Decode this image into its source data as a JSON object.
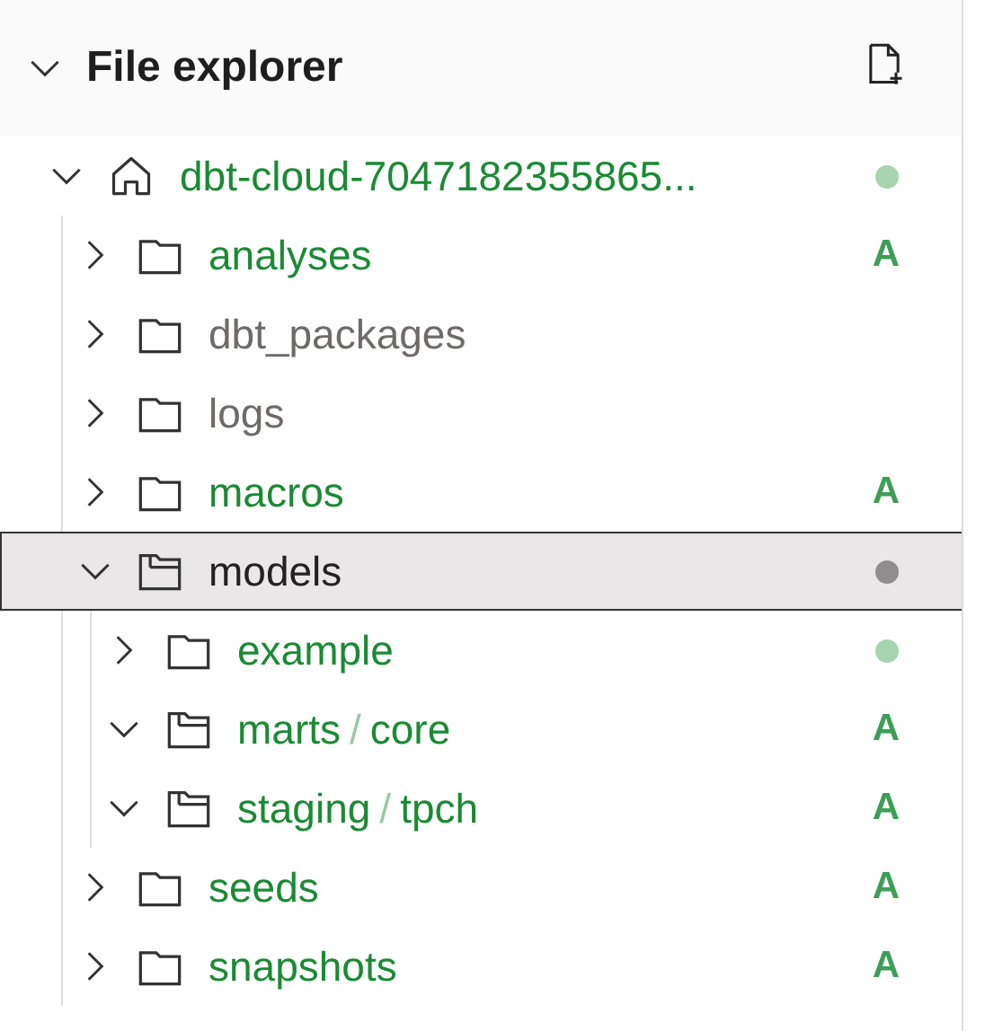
{
  "panel": {
    "title": "File explorer",
    "expanded": true
  },
  "tree": [
    {
      "kind": "root",
      "segments": [
        "dbt-cloud-7047182355865..."
      ],
      "color": "#1b8a34",
      "expanded": true,
      "selected": false,
      "badge": {
        "kind": "dot",
        "color": "#a6d5ad"
      },
      "children": [
        {
          "kind": "folder",
          "segments": [
            "analyses"
          ],
          "color": "#1b8a34",
          "expanded": false,
          "selected": false,
          "badge": {
            "kind": "letter",
            "text": "A"
          }
        },
        {
          "kind": "folder",
          "segments": [
            "dbt_packages"
          ],
          "color": "#6f6a6a",
          "expanded": false,
          "selected": false
        },
        {
          "kind": "folder",
          "segments": [
            "logs"
          ],
          "color": "#6f6a6a",
          "expanded": false,
          "selected": false
        },
        {
          "kind": "folder",
          "segments": [
            "macros"
          ],
          "color": "#1b8a34",
          "expanded": false,
          "selected": false,
          "badge": {
            "kind": "letter",
            "text": "A"
          }
        },
        {
          "kind": "folder",
          "segments": [
            "models"
          ],
          "color": "#222222",
          "expanded": true,
          "selected": true,
          "badge": {
            "kind": "dot",
            "color": "#8f8d8e"
          },
          "children": [
            {
              "kind": "folder",
              "segments": [
                "example"
              ],
              "color": "#1b8a34",
              "expanded": false,
              "selected": false,
              "badge": {
                "kind": "dot",
                "color": "#a6d5ad"
              }
            },
            {
              "kind": "folder",
              "segments": [
                "marts",
                "/",
                "core"
              ],
              "color": "#1b8a34",
              "expanded": true,
              "selected": false,
              "badge": {
                "kind": "letter",
                "text": "A"
              }
            },
            {
              "kind": "folder",
              "segments": [
                "staging",
                "/",
                "tpch"
              ],
              "color": "#1b8a34",
              "expanded": true,
              "selected": false,
              "badge": {
                "kind": "letter",
                "text": "A"
              }
            }
          ]
        },
        {
          "kind": "folder",
          "segments": [
            "seeds"
          ],
          "color": "#1b8a34",
          "expanded": false,
          "selected": false,
          "badge": {
            "kind": "letter",
            "text": "A"
          }
        },
        {
          "kind": "folder",
          "segments": [
            "snapshots"
          ],
          "color": "#1b8a34",
          "expanded": false,
          "selected": false,
          "badge": {
            "kind": "letter",
            "text": "A"
          }
        }
      ]
    }
  ]
}
